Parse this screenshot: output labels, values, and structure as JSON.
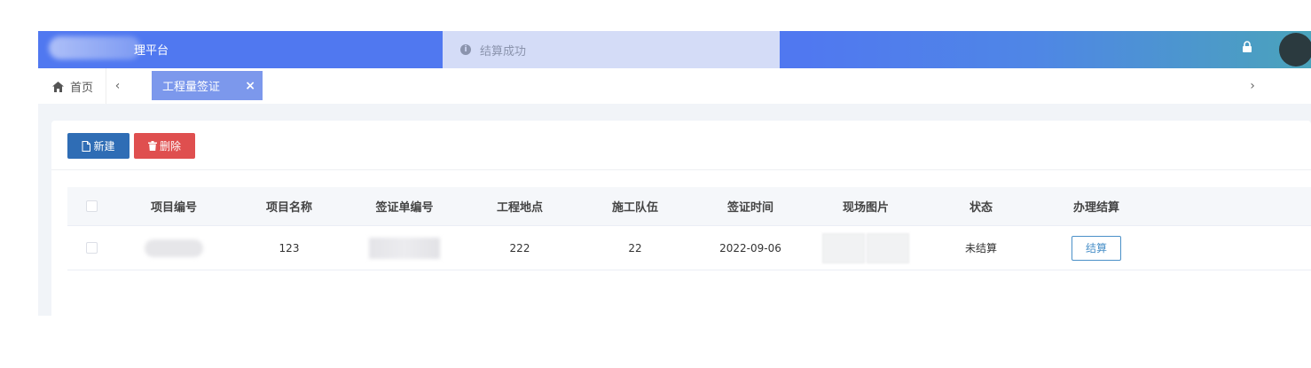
{
  "header": {
    "app_title": "理平台",
    "toast_text": "结算成功"
  },
  "tabs": {
    "home_label": "首页",
    "prev_symbol": "‹",
    "next_symbol": "›",
    "active_label": "工程量签证",
    "close_symbol": "×"
  },
  "toolbar": {
    "new_label": "新建",
    "delete_label": "删除"
  },
  "table": {
    "columns": [
      "项目编号",
      "项目名称",
      "签证单编号",
      "工程地点",
      "施工队伍",
      "签证时间",
      "现场图片",
      "状态",
      "办理结算"
    ],
    "rows": [
      {
        "project_name": "123",
        "location": "222",
        "team": "22",
        "date": "2022-09-06",
        "status": "未结算",
        "action_label": "结算"
      }
    ]
  },
  "colors": {
    "header_blue": "#5078f0",
    "header_teal": "#4aa3bb",
    "tab_active": "#7c98ec",
    "btn_new": "#2f6db5",
    "btn_delete": "#df4f4f",
    "settle_border": "#4a90c8"
  }
}
